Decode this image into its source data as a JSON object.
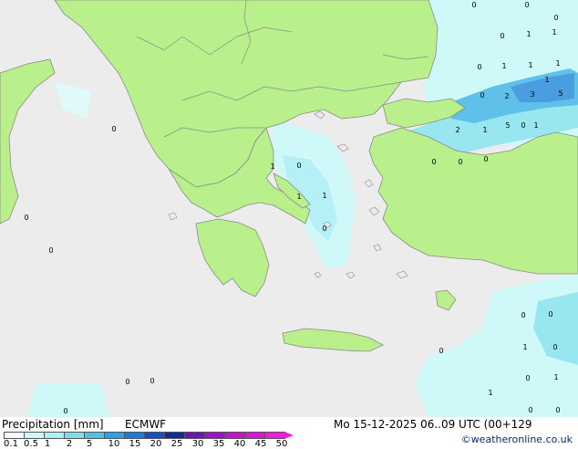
{
  "map": {
    "colors": {
      "sea": "#ececec",
      "land": "#b9f08c",
      "coast": "#8a8a8a",
      "precip_light": "#cff8f8",
      "precip_mid": "#98e6f0",
      "precip_heavy": "#5fc0ea",
      "precip_strong": "#4a9ee0"
    },
    "point_labels": [
      "0",
      "0",
      "0",
      "1",
      "1",
      "1",
      "0",
      "0",
      "1",
      "1",
      "1",
      "0",
      "2",
      "3",
      "5",
      "5",
      "2",
      "1",
      "0",
      "1",
      "0",
      "0",
      "0",
      "0",
      "1",
      "0",
      "0",
      "1",
      "1",
      "0",
      "0",
      "1",
      "0",
      "0",
      "0",
      "0",
      "0",
      "0",
      "0",
      "0",
      "1",
      "1",
      "0",
      "0"
    ]
  },
  "footer": {
    "title": "Precipitation [mm]",
    "model": "ECMWF",
    "datetime": "Mo 15-12-2025 06..09 UTC (00+129",
    "copyright": "©weatheronline.co.uk",
    "scale_labels": [
      "0.1",
      "0.5",
      "1",
      "2",
      "5",
      "10",
      "15",
      "20",
      "25",
      "30",
      "35",
      "40",
      "45",
      "50"
    ],
    "scale_colors": [
      "#f0fafa",
      "#cff8f8",
      "#aaf0f4",
      "#7edcee",
      "#4cc2ea",
      "#2ea0e4",
      "#1e78d8",
      "#1450c0",
      "#0c2c9c",
      "#6a14b4",
      "#9a14c4",
      "#c014cc",
      "#dc14d8",
      "#f01ce0"
    ]
  }
}
